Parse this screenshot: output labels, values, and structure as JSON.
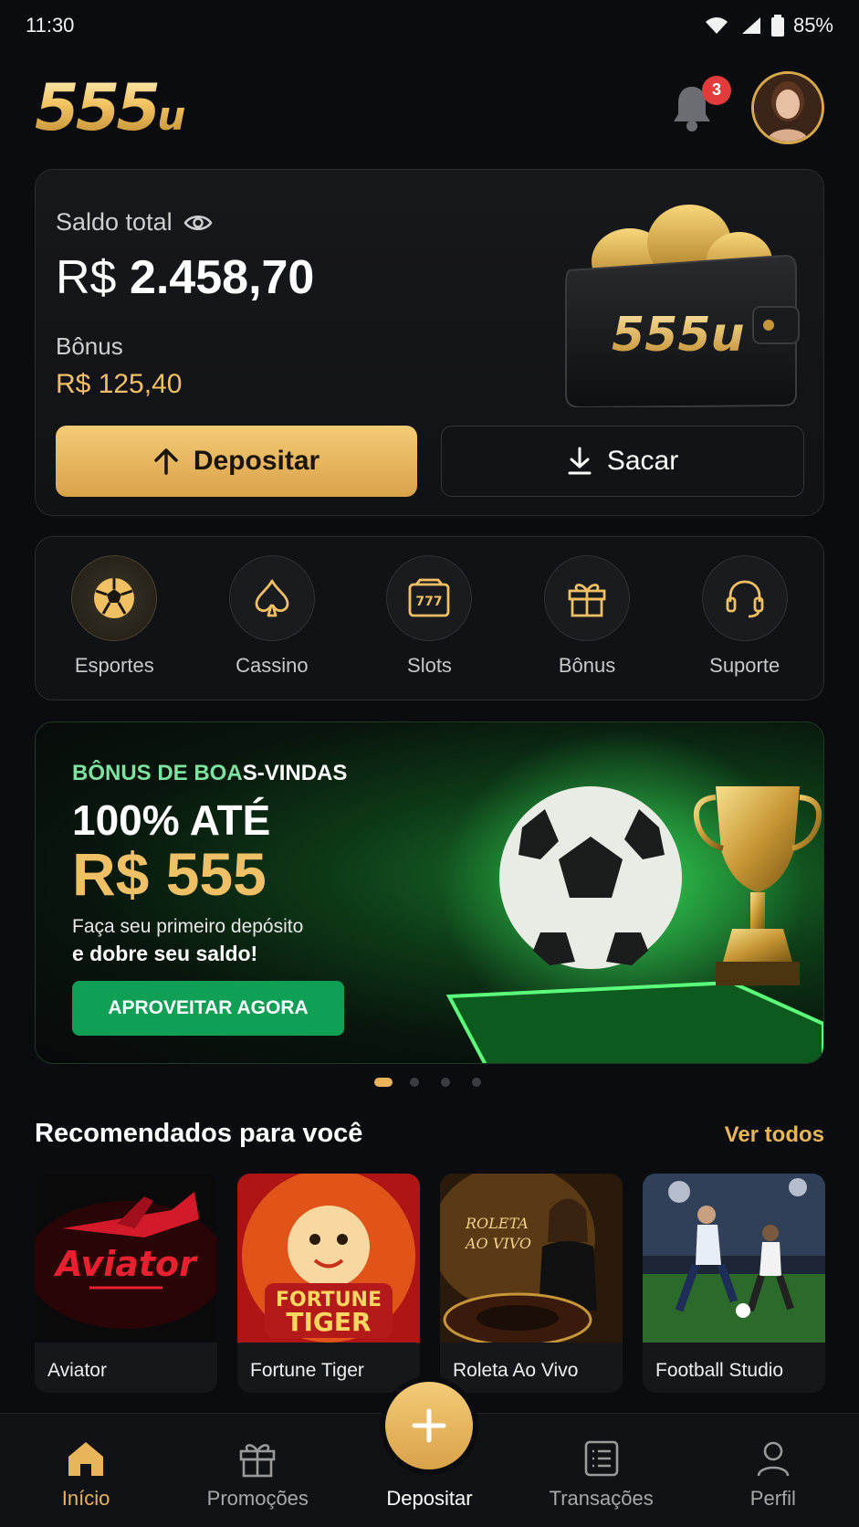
{
  "status_bar": {
    "time": "11:30",
    "battery": "85%"
  },
  "header": {
    "logo_main": "555",
    "logo_suffix": "u",
    "notification_count": "3"
  },
  "balance": {
    "label": "Saldo total",
    "currency": "R$",
    "amount": "2.458,70",
    "bonus_label": "Bônus",
    "bonus_value": "R$ 125,40",
    "wallet_logo": "555u",
    "deposit_label": "Depositar",
    "withdraw_label": "Sacar"
  },
  "categories": [
    {
      "label": "Esportes",
      "icon": "soccer-ball-icon",
      "active": true
    },
    {
      "label": "Cassino",
      "icon": "spade-icon"
    },
    {
      "label": "Slots",
      "icon": "slot-machine-icon"
    },
    {
      "label": "Bônus",
      "icon": "gift-icon"
    },
    {
      "label": "Suporte",
      "icon": "headset-icon"
    }
  ],
  "banner": {
    "kicker_highlight": "BÔNUS DE BOA",
    "kicker_rest": "S-VINDAS",
    "headline": "100% ATÉ",
    "amount": "R$ 555",
    "sub1": "Faça seu primeiro depósito",
    "sub2": "e dobre seu saldo!",
    "cta": "APROVEITAR AGORA",
    "slides": 4,
    "active_slide": 1
  },
  "recommended": {
    "title": "Recomendados para você",
    "see_all": "Ver todos",
    "games": [
      {
        "name": "Aviator",
        "art_text": "Aviator"
      },
      {
        "name": "Fortune Tiger",
        "art_text_1": "FORTUNE",
        "art_text_2": "TIGER"
      },
      {
        "name": "Roleta Ao Vivo",
        "art_text_1": "ROLETA",
        "art_text_2": "AO VIVO"
      },
      {
        "name": "Football Studio"
      }
    ]
  },
  "nav": {
    "home": "Início",
    "promos": "Promoções",
    "deposit": "Depositar",
    "transactions": "Transações",
    "profile": "Perfil"
  },
  "colors": {
    "accent": "#e8b55a",
    "cta_green": "#0f9f55",
    "badge": "#e23b3b"
  }
}
